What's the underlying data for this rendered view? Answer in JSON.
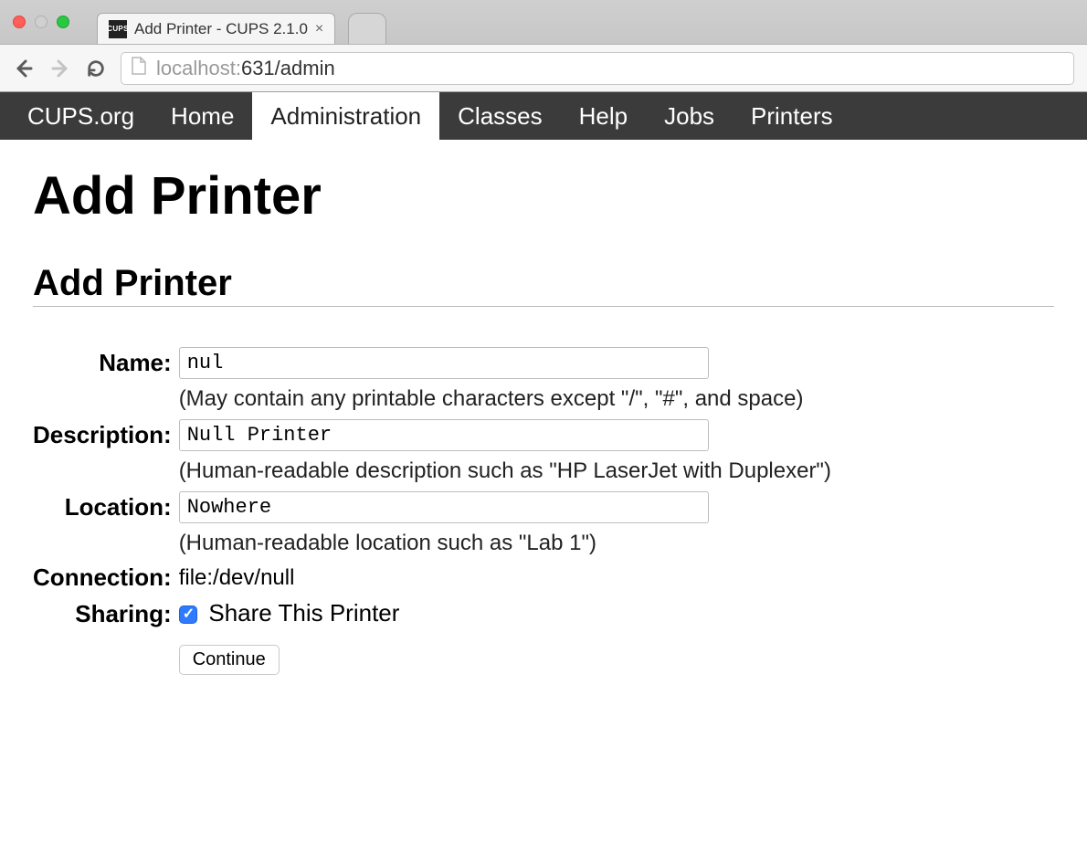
{
  "browser": {
    "tab_title": "Add Printer - CUPS 2.1.0",
    "favicon_text": "CUPS",
    "url_scheme_host": "localhost:",
    "url_port_path": "631/admin"
  },
  "nav": {
    "items": [
      {
        "label": "CUPS.org",
        "active": false
      },
      {
        "label": "Home",
        "active": false
      },
      {
        "label": "Administration",
        "active": true
      },
      {
        "label": "Classes",
        "active": false
      },
      {
        "label": "Help",
        "active": false
      },
      {
        "label": "Jobs",
        "active": false
      },
      {
        "label": "Printers",
        "active": false
      }
    ]
  },
  "page": {
    "title": "Add Printer",
    "section_title": "Add Printer"
  },
  "form": {
    "name": {
      "label": "Name:",
      "value": "nul",
      "hint": "(May contain any printable characters except \"/\", \"#\", and space)"
    },
    "description": {
      "label": "Description:",
      "value": "Null Printer",
      "hint": "(Human-readable description such as \"HP LaserJet with Duplexer\")"
    },
    "location": {
      "label": "Location:",
      "value": "Nowhere",
      "hint": "(Human-readable location such as \"Lab 1\")"
    },
    "connection": {
      "label": "Connection:",
      "value": "file:/dev/null"
    },
    "sharing": {
      "label": "Sharing:",
      "checkbox_label": "Share This Printer",
      "checked": true
    },
    "submit_label": "Continue"
  }
}
